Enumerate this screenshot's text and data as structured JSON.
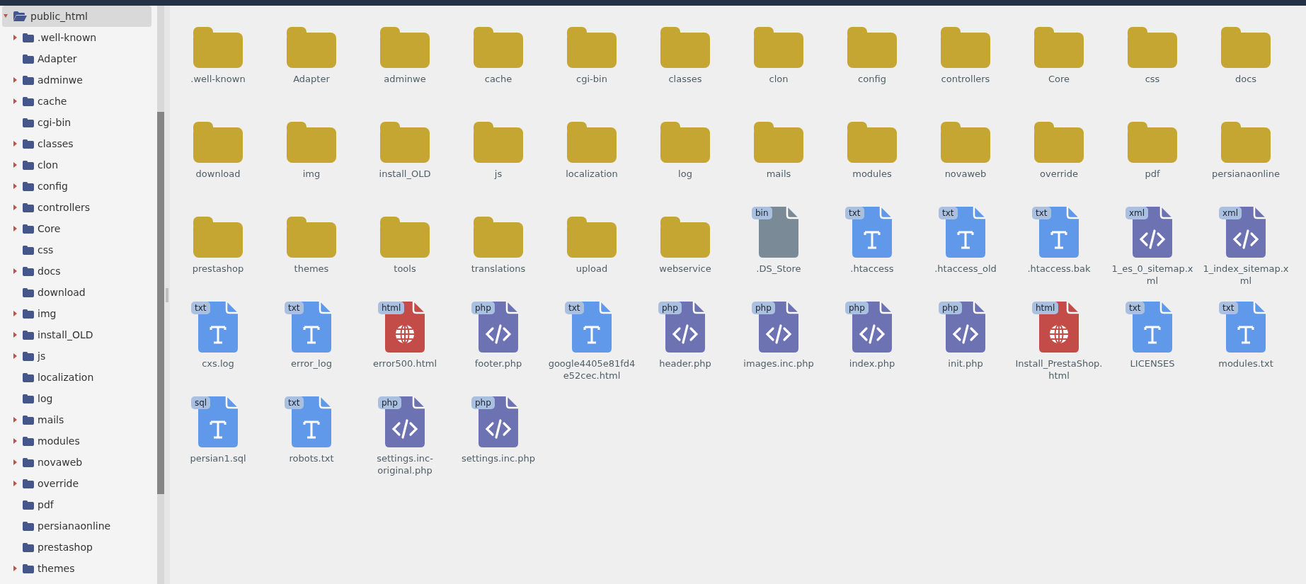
{
  "tree": {
    "label": "public_html",
    "expanded": true,
    "selected": true,
    "children": [
      {
        "label": ".well-known",
        "expandable": true,
        "selected": false
      },
      {
        "label": "Adapter",
        "expandable": false,
        "selected": false
      },
      {
        "label": "adminwe",
        "expandable": true,
        "selected": false
      },
      {
        "label": "cache",
        "expandable": true,
        "selected": false
      },
      {
        "label": "cgi-bin",
        "expandable": false,
        "selected": false
      },
      {
        "label": "classes",
        "expandable": true,
        "selected": false
      },
      {
        "label": "clon",
        "expandable": true,
        "selected": false
      },
      {
        "label": "config",
        "expandable": true,
        "selected": false
      },
      {
        "label": "controllers",
        "expandable": true,
        "selected": false
      },
      {
        "label": "Core",
        "expandable": true,
        "selected": false
      },
      {
        "label": "css",
        "expandable": false,
        "selected": false
      },
      {
        "label": "docs",
        "expandable": true,
        "selected": false
      },
      {
        "label": "download",
        "expandable": false,
        "selected": false
      },
      {
        "label": "img",
        "expandable": true,
        "selected": false
      },
      {
        "label": "install_OLD",
        "expandable": true,
        "selected": false
      },
      {
        "label": "js",
        "expandable": true,
        "selected": false
      },
      {
        "label": "localization",
        "expandable": false,
        "selected": false
      },
      {
        "label": "log",
        "expandable": false,
        "selected": false
      },
      {
        "label": "mails",
        "expandable": true,
        "selected": false
      },
      {
        "label": "modules",
        "expandable": true,
        "selected": false
      },
      {
        "label": "novaweb",
        "expandable": true,
        "selected": false
      },
      {
        "label": "override",
        "expandable": true,
        "selected": false
      },
      {
        "label": "pdf",
        "expandable": false,
        "selected": false
      },
      {
        "label": "persianaonline",
        "expandable": false,
        "selected": false
      },
      {
        "label": "prestashop",
        "expandable": false,
        "selected": false
      },
      {
        "label": "themes",
        "expandable": true,
        "selected": false
      }
    ]
  },
  "items": [
    {
      "kind": "folder",
      "name": ".well-known"
    },
    {
      "kind": "folder",
      "name": "Adapter"
    },
    {
      "kind": "folder",
      "name": "adminwe"
    },
    {
      "kind": "folder",
      "name": "cache"
    },
    {
      "kind": "folder",
      "name": "cgi-bin"
    },
    {
      "kind": "folder",
      "name": "classes"
    },
    {
      "kind": "folder",
      "name": "clon"
    },
    {
      "kind": "folder",
      "name": "config"
    },
    {
      "kind": "folder",
      "name": "controllers"
    },
    {
      "kind": "folder",
      "name": "Core"
    },
    {
      "kind": "folder",
      "name": "css"
    },
    {
      "kind": "folder",
      "name": "docs"
    },
    {
      "kind": "folder",
      "name": "download"
    },
    {
      "kind": "folder",
      "name": "img"
    },
    {
      "kind": "folder",
      "name": "install_OLD"
    },
    {
      "kind": "folder",
      "name": "js"
    },
    {
      "kind": "folder",
      "name": "localization"
    },
    {
      "kind": "folder",
      "name": "log"
    },
    {
      "kind": "folder",
      "name": "mails"
    },
    {
      "kind": "folder",
      "name": "modules"
    },
    {
      "kind": "folder",
      "name": "novaweb"
    },
    {
      "kind": "folder",
      "name": "override"
    },
    {
      "kind": "folder",
      "name": "pdf"
    },
    {
      "kind": "folder",
      "name": "persianaonline"
    },
    {
      "kind": "folder",
      "name": "prestashop"
    },
    {
      "kind": "folder",
      "name": "themes"
    },
    {
      "kind": "folder",
      "name": "tools"
    },
    {
      "kind": "folder",
      "name": "translations"
    },
    {
      "kind": "folder",
      "name": "upload"
    },
    {
      "kind": "folder",
      "name": "webservice"
    },
    {
      "kind": "binary",
      "name": ".DS_Store",
      "badge": "bin"
    },
    {
      "kind": "text",
      "name": ".htaccess",
      "badge": "txt"
    },
    {
      "kind": "text",
      "name": ".htaccess_old",
      "badge": "txt"
    },
    {
      "kind": "text",
      "name": ".htaccess.bak",
      "badge": "txt"
    },
    {
      "kind": "code",
      "name": "1_es_0_sitemap.xml",
      "badge": "xml"
    },
    {
      "kind": "code",
      "name": "1_index_sitemap.xml",
      "badge": "xml"
    },
    {
      "kind": "text",
      "name": "cxs.log",
      "badge": "txt"
    },
    {
      "kind": "text",
      "name": "error_log",
      "badge": "txt"
    },
    {
      "kind": "web",
      "name": "error500.html",
      "badge": "html"
    },
    {
      "kind": "code",
      "name": "footer.php",
      "badge": "php"
    },
    {
      "kind": "text",
      "name": "google4405e81fd4e52cec.html",
      "badge": "txt"
    },
    {
      "kind": "code",
      "name": "header.php",
      "badge": "php"
    },
    {
      "kind": "code",
      "name": "images.inc.php",
      "badge": "php"
    },
    {
      "kind": "code",
      "name": "index.php",
      "badge": "php"
    },
    {
      "kind": "code",
      "name": "init.php",
      "badge": "php"
    },
    {
      "kind": "web",
      "name": "Install_PrestaShop.html",
      "badge": "html"
    },
    {
      "kind": "text",
      "name": "LICENSES",
      "badge": "txt"
    },
    {
      "kind": "text",
      "name": "modules.txt",
      "badge": "txt"
    },
    {
      "kind": "text",
      "name": "persian1.sql",
      "badge": "sql"
    },
    {
      "kind": "text",
      "name": "robots.txt",
      "badge": "txt"
    },
    {
      "kind": "code",
      "name": "settings.inc-original.php",
      "badge": "php"
    },
    {
      "kind": "code",
      "name": "settings.inc.php",
      "badge": "php"
    }
  ]
}
